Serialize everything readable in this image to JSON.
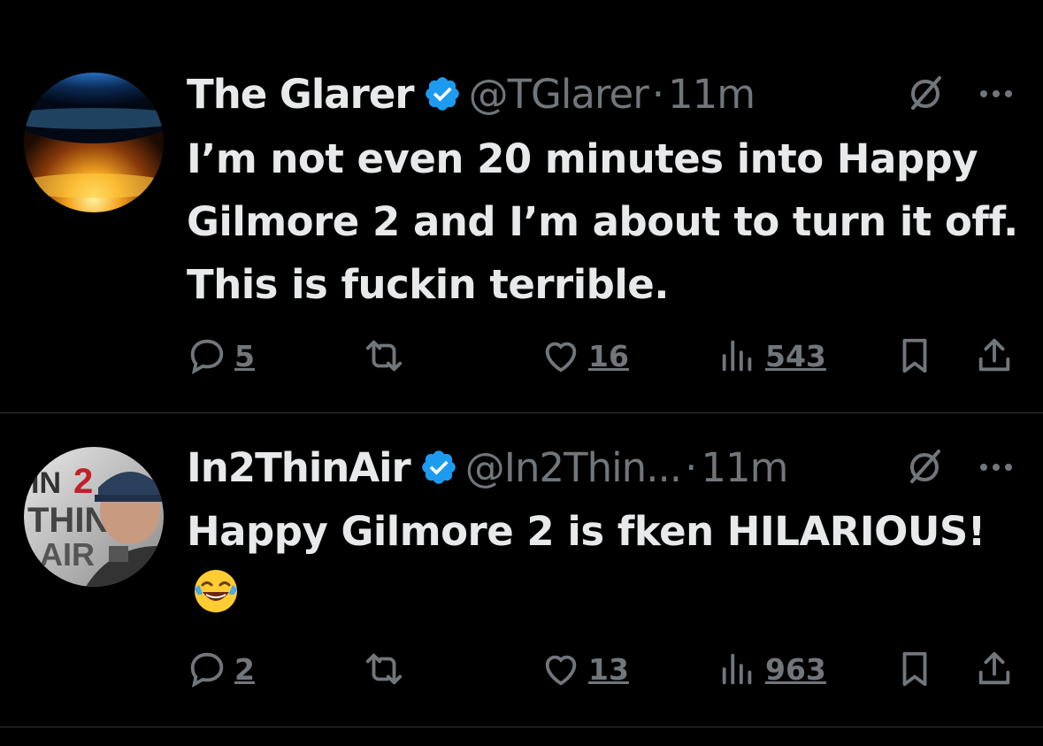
{
  "tweets": [
    {
      "display_name": "The Glarer",
      "handle": "@TGlarer",
      "separator": "·",
      "time": "11m",
      "text": "I’m not even 20 minutes into Happy Gilmore 2 and I’m about to turn it off. This is fuckin terrible.",
      "emoji": "",
      "replies": "5",
      "likes": "16",
      "views": "543"
    },
    {
      "display_name": "In2ThinAir",
      "handle": "@In2Thin...",
      "separator": "·",
      "time": "11m",
      "text": "Happy Gilmore 2 is fken HILARIOUS!",
      "emoji": "face-with-tears-of-joy",
      "replies": "2",
      "likes": "13",
      "views": "963",
      "avatar_text": "IN2 THIN AIR"
    }
  ],
  "colors": {
    "background": "#000000",
    "text": "#e7e9ea",
    "muted": "#71767b",
    "verified": "#1d9bf0",
    "divider": "#2f3336"
  },
  "icons": [
    "verified-icon",
    "grok-icon",
    "more-icon",
    "reply-icon",
    "retweet-icon",
    "like-icon",
    "views-icon",
    "bookmark-icon",
    "share-icon"
  ]
}
